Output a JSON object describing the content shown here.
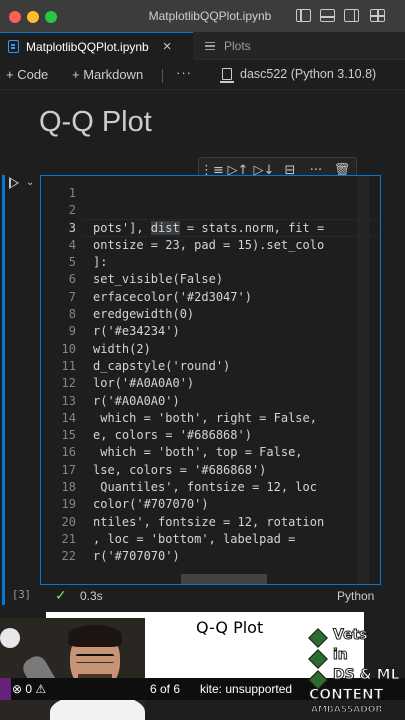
{
  "window": {
    "title": "MatplotlibQQPlot.ipynb"
  },
  "tabs": [
    {
      "label": "MatplotlibQQPlot.ipynb",
      "close": "×"
    },
    {
      "label": "Plots"
    }
  ],
  "toolbar": {
    "add_code": "+ Code",
    "add_markdown": "+ Markdown",
    "more": "···",
    "kernel": "dasc522 (Python 3.10.8)"
  },
  "notebook": {
    "heading": "Q-Q Plot",
    "cell_toolbar_icons": [
      "run-by-line-icon",
      "execute-above-icon",
      "execute-below-icon",
      "split-cell-icon",
      "more-icon",
      "delete-icon"
    ],
    "cell": {
      "line_numbers": [
        "1",
        "2",
        "3",
        "4",
        "5",
        "6",
        "7",
        "8",
        "9",
        "10",
        "11",
        "12",
        "13",
        "14",
        "15",
        "16",
        "17",
        "18",
        "19",
        "20",
        "21",
        "22"
      ],
      "lines": [
        "",
        "",
        "pots'], ",
        "ontsize = 23, pad = 15).set_colo",
        "]:",
        "set_visible(False)",
        "erfacecolor('#2d3047')",
        "eredgewidth(0)",
        "r('#e34234')",
        "width(2)",
        "d_capstyle('round')",
        "lor('#A0A0A0')",
        "r('#A0A0A0')",
        " which = 'both', right = False,",
        "e, colors = '#686868')",
        " which = 'both', top = False,",
        "lse, colors = '#686868')",
        " Quantiles', fontsize = 12, loc",
        "color('#707070')",
        "ntiles', fontsize = 12, rotation",
        ", loc = 'bottom', labelpad =",
        "r('#707070')"
      ],
      "line3_highlight": "dist",
      "line3_rest": " = stats.norm, fit =",
      "execution_count": "[3]",
      "exec_time": "0.3s",
      "language": "Python"
    },
    "output": {
      "plot_title": "Q-Q Plot"
    }
  },
  "statusbar": {
    "problems": "⊗ 0 ⚠",
    "cells": "6 of 6",
    "kite": "kite: unsupported"
  },
  "badge": {
    "line1": "Vets",
    "line2": "in",
    "line3": "DS & ML",
    "line4": "CONTENT",
    "line5": "AMBASSADOR"
  }
}
